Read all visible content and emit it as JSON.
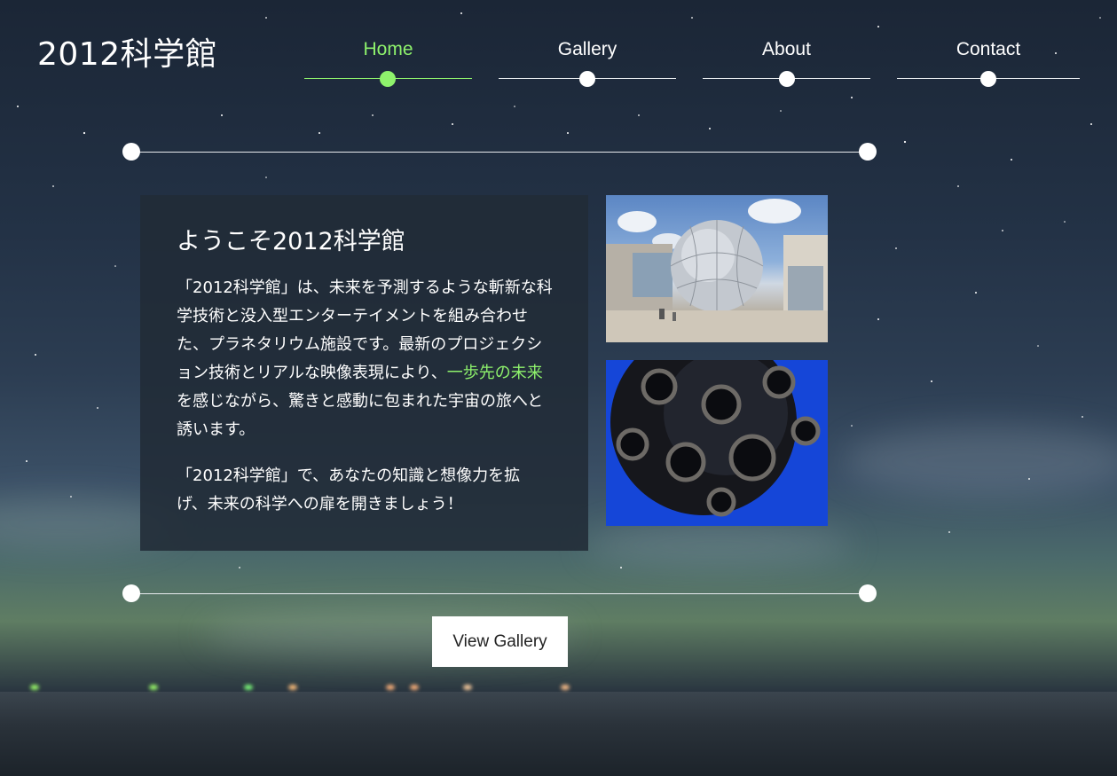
{
  "brand": {
    "logo": "2012科学館"
  },
  "nav": {
    "items": [
      {
        "label": "Home",
        "active": true
      },
      {
        "label": "Gallery",
        "active": false
      },
      {
        "label": "About",
        "active": false
      },
      {
        "label": "Contact",
        "active": false
      }
    ]
  },
  "welcome": {
    "title": "ようこそ2012科学館",
    "p1_before": "「2012科学館」は、未来を予測するような斬新な科学技術と没入型エンターテイメントを組み合わせた、プラネタリウム施設です。最新のプロジェクション技術とリアルな映像表現により、",
    "p1_highlight": "一歩先の未来",
    "p1_after": "を感じながら、驚きと感動に包まれた宇宙の旅へと誘います。",
    "p2": "「2012科学館」で、あなたの知識と想像力を拡げ、未来の科学への扉を開きましょう！"
  },
  "photos": [
    {
      "icon": "mirrored-sphere-planetarium-photo"
    },
    {
      "icon": "planetarium-projector-photo"
    }
  ],
  "cta": {
    "label": "View Gallery"
  },
  "colors": {
    "accent": "#8ef26c",
    "panel": "#212b37"
  }
}
